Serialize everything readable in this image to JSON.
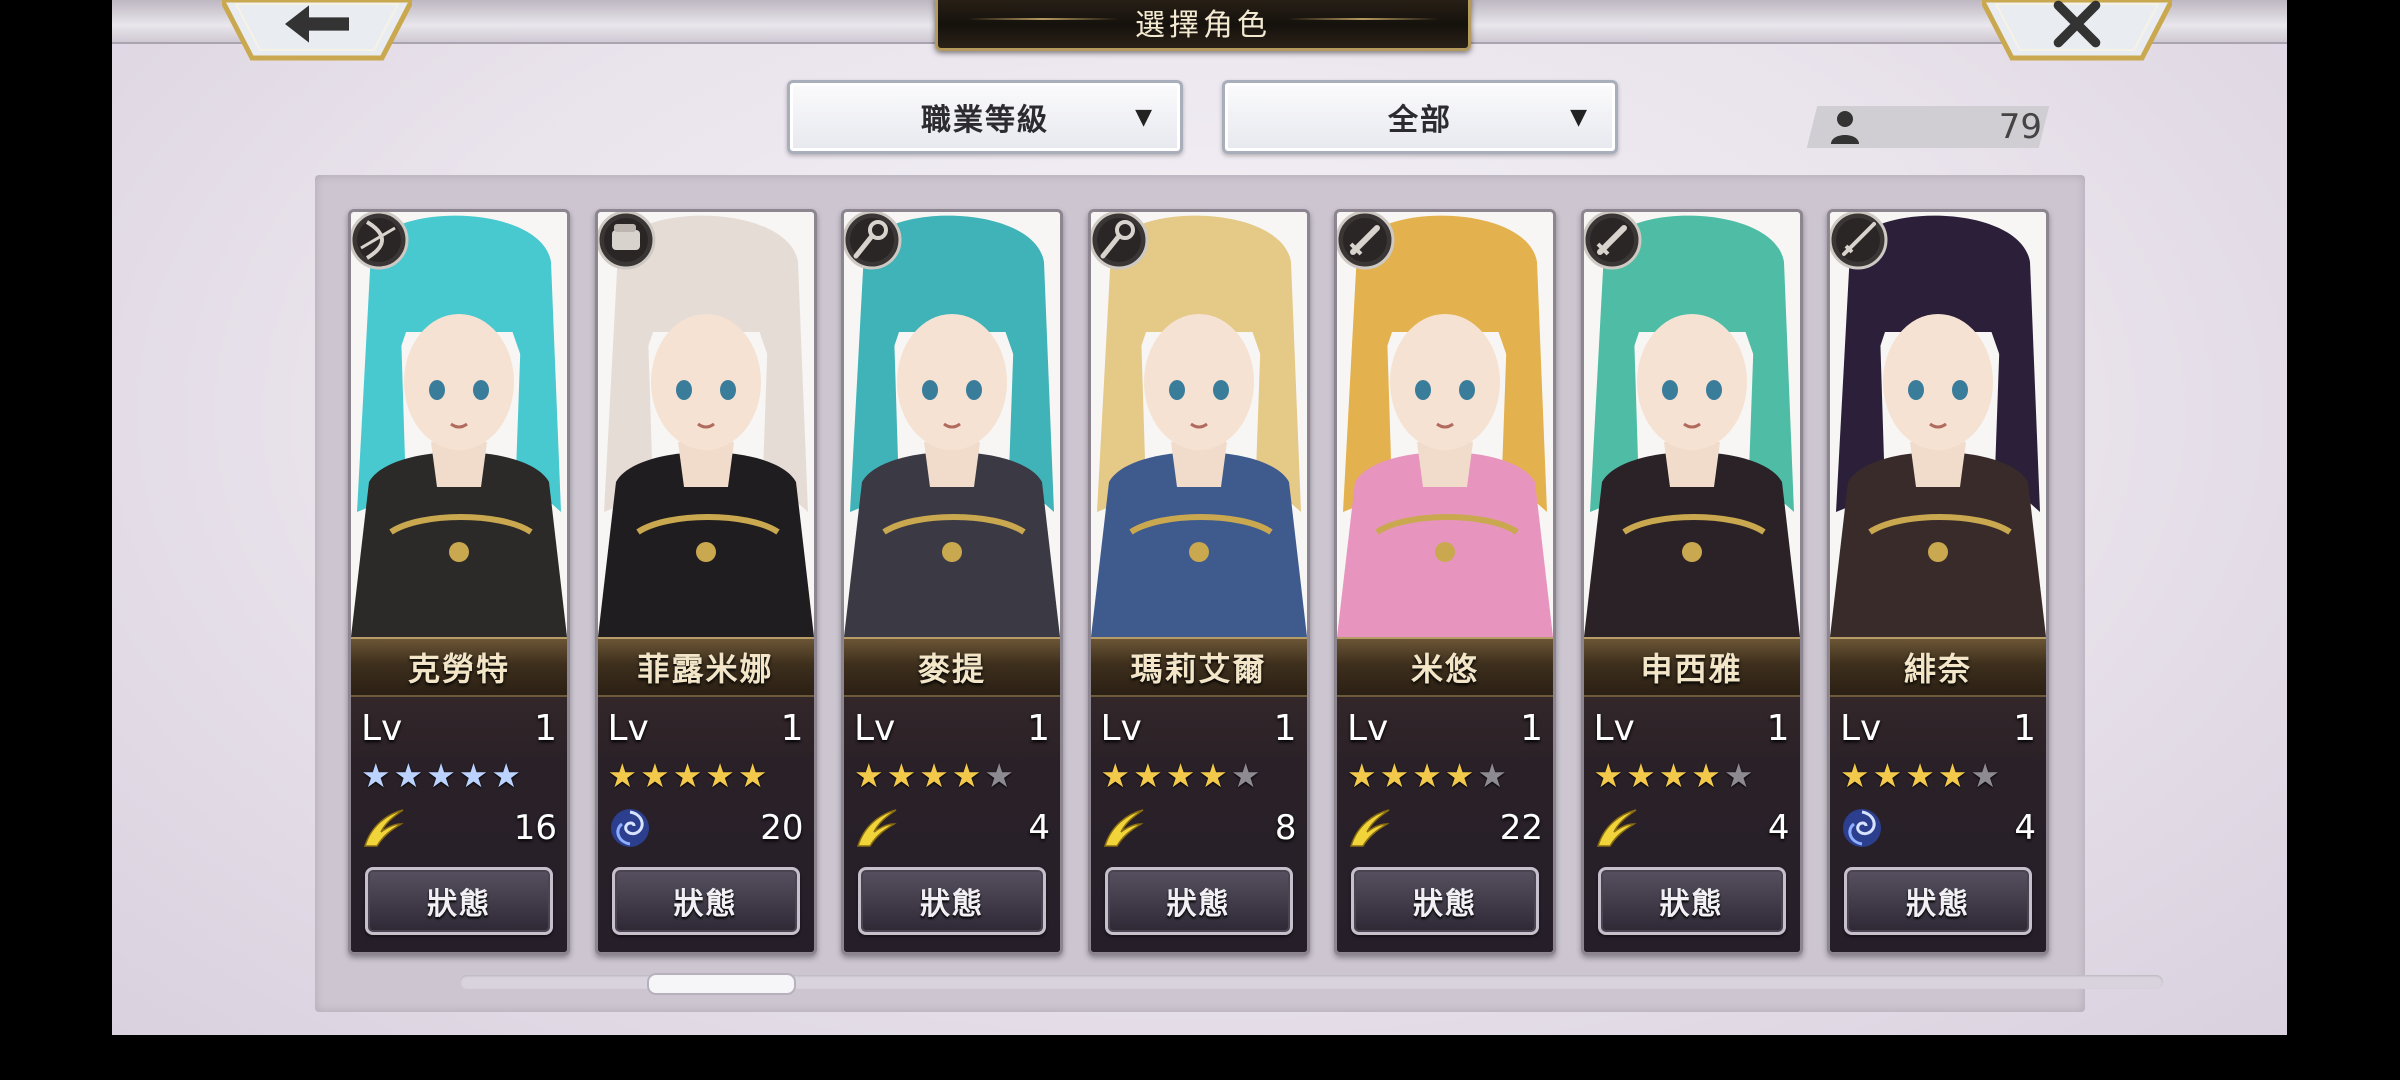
{
  "header": {
    "title": "選擇角色"
  },
  "nav": {
    "back_icon": "back-arrow-icon",
    "close_icon": "close-x-icon"
  },
  "filters": {
    "job_level": {
      "label": "職業等級",
      "icon": "chevron-down-icon"
    },
    "category": {
      "label": "全部",
      "icon": "chevron-down-icon"
    }
  },
  "roster": {
    "count": "79",
    "icon": "person-icon"
  },
  "characters": [
    {
      "name": "克勞特",
      "lv_label": "Lv",
      "level": "1",
      "stars": 5,
      "star_style": "blue",
      "element": "wind-wing-icon",
      "value": "16",
      "button": "狀態",
      "class_icon": "bow-class-icon",
      "hair": "#48c8cf",
      "outfit": "#2b2a28"
    },
    {
      "name": "菲露米娜",
      "lv_label": "Lv",
      "level": "1",
      "stars": 5,
      "star_style": "gold",
      "element": "swirl-icon",
      "value": "20",
      "button": "狀態",
      "class_icon": "fist-class-icon",
      "hair": "#e6dcd6",
      "outfit": "#1f1d1f"
    },
    {
      "name": "麥提",
      "lv_label": "Lv",
      "level": "1",
      "stars": 4,
      "star_style": "gold",
      "element": "wind-wing-icon",
      "value": "4",
      "button": "狀態",
      "class_icon": "staff-class-icon",
      "hair": "#3fb3b8",
      "outfit": "#3b3a44"
    },
    {
      "name": "瑪莉艾爾",
      "lv_label": "Lv",
      "level": "1",
      "stars": 4,
      "star_style": "gold",
      "element": "wind-wing-icon",
      "value": "8",
      "button": "狀態",
      "class_icon": "staff-class-icon",
      "hair": "#e4c987",
      "outfit": "#3f5a8c"
    },
    {
      "name": "米悠",
      "lv_label": "Lv",
      "level": "1",
      "stars": 4,
      "star_style": "gold",
      "element": "wind-wing-icon",
      "value": "22",
      "button": "狀態",
      "class_icon": "sword-class-icon",
      "hair": "#e3b14e",
      "outfit": "#e795be"
    },
    {
      "name": "申西雅",
      "lv_label": "Lv",
      "level": "1",
      "stars": 4,
      "star_style": "gold",
      "element": "wind-wing-icon",
      "value": "4",
      "button": "狀態",
      "class_icon": "sword-class-icon",
      "hair": "#4fbda5",
      "outfit": "#2a2226"
    },
    {
      "name": "緋奈",
      "lv_label": "Lv",
      "level": "1",
      "stars": 4,
      "star_style": "gold",
      "element": "swirl-icon",
      "value": "4",
      "button": "狀態",
      "class_icon": "katana-class-icon",
      "hair": "#2b1f3a",
      "outfit": "#3a2b2b"
    }
  ],
  "scroll": {
    "position": 0.12
  }
}
